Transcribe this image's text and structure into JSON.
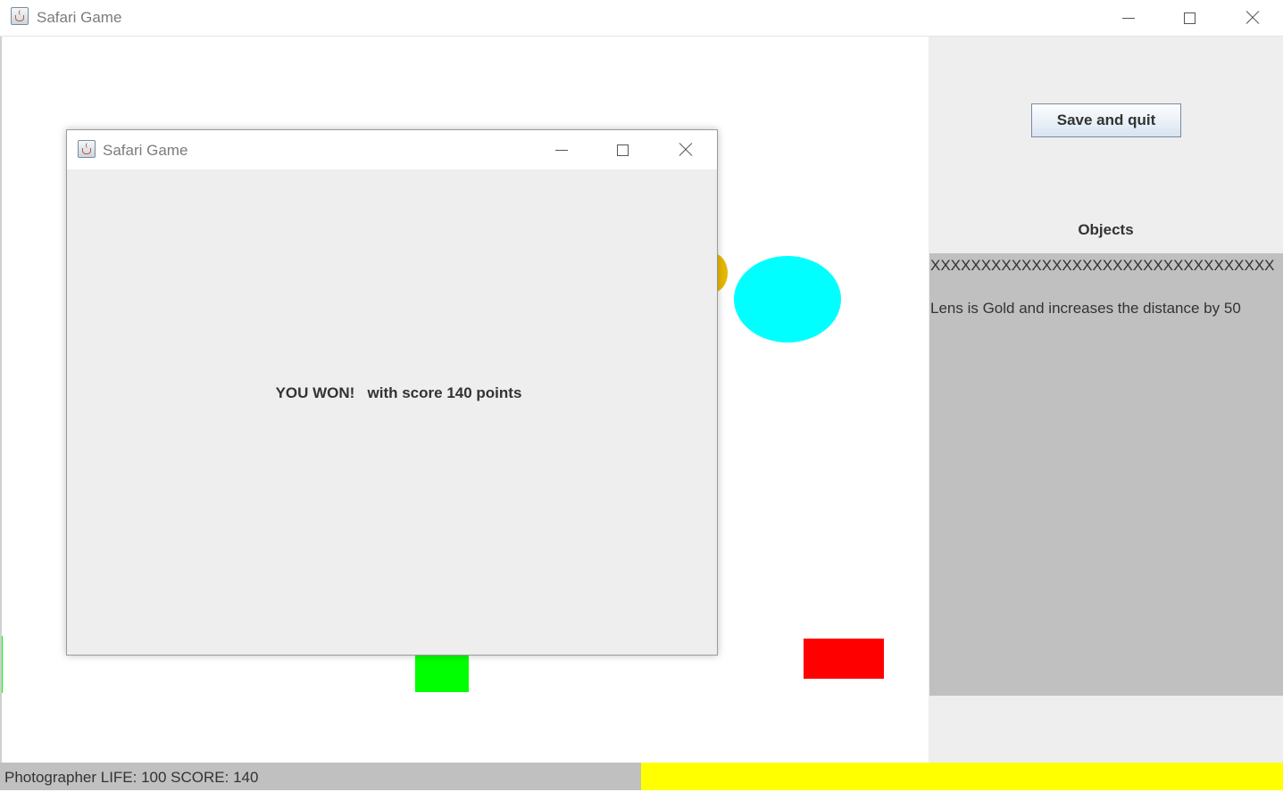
{
  "window": {
    "title": "Safari Game",
    "icon": "java-cup-icon",
    "controls": [
      "minimize-icon",
      "maximize-icon",
      "close-icon"
    ]
  },
  "side_panel": {
    "save_button": "Save and quit",
    "objects_label": "Objects",
    "objects_list": [
      "XXXXXXXXXXXXXXXXXXXXXXXXXXXXXXXXXX",
      "Lens is Gold and increases the distance by 50"
    ]
  },
  "status_bar": {
    "text": "Photographer LIFE: 100 SCORE: 140",
    "left_color": "#c0c0c0",
    "right_color": "#ffff00"
  },
  "dialog": {
    "title": "Safari Game",
    "message": "YOU WON!   with score 140 points"
  },
  "game_objects": [
    {
      "name": "cyan-ellipse",
      "color": "#00ffff"
    },
    {
      "name": "gold-circle",
      "color": "#e6b800"
    },
    {
      "name": "green-square",
      "color": "#00ff00"
    },
    {
      "name": "red-rectangle",
      "color": "#ff0000"
    },
    {
      "name": "green-edge",
      "color": "#00ff00"
    }
  ]
}
